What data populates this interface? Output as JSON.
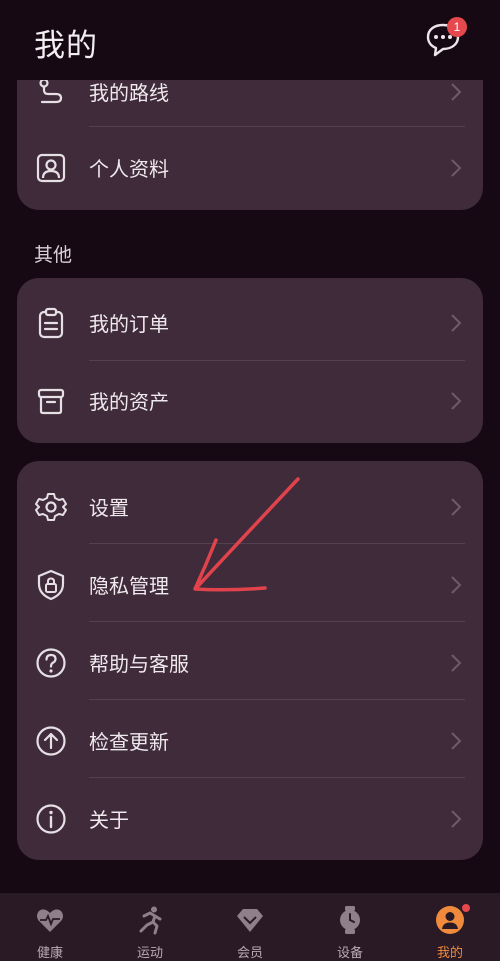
{
  "header": {
    "title": "我的",
    "message_badge": "1"
  },
  "profile_section": {
    "items": [
      {
        "label": "我的路线",
        "icon": "route-icon"
      },
      {
        "label": "个人资料",
        "icon": "id-card-icon"
      }
    ]
  },
  "other_section": {
    "title": "其他",
    "items": [
      {
        "label": "我的订单",
        "icon": "clipboard-icon"
      },
      {
        "label": "我的资产",
        "icon": "box-icon"
      }
    ]
  },
  "settings_section": {
    "items": [
      {
        "label": "设置",
        "icon": "gear-icon"
      },
      {
        "label": "隐私管理",
        "icon": "shield-lock-icon"
      },
      {
        "label": "帮助与客服",
        "icon": "help-circle-icon"
      },
      {
        "label": "检查更新",
        "icon": "arrow-up-circle-icon"
      },
      {
        "label": "关于",
        "icon": "info-circle-icon"
      }
    ]
  },
  "tabbar": {
    "active_color": "#f08a3c",
    "tabs": [
      {
        "label": "健康",
        "icon": "heart-pulse-icon"
      },
      {
        "label": "运动",
        "icon": "running-icon"
      },
      {
        "label": "会员",
        "icon": "diamond-icon"
      },
      {
        "label": "设备",
        "icon": "watch-icon"
      },
      {
        "label": "我的",
        "icon": "user-icon",
        "active": true
      }
    ]
  },
  "colors": {
    "background": "#170913",
    "card": "#3f2b3a",
    "badge": "#e5484d",
    "annotation": "#e0434b"
  }
}
